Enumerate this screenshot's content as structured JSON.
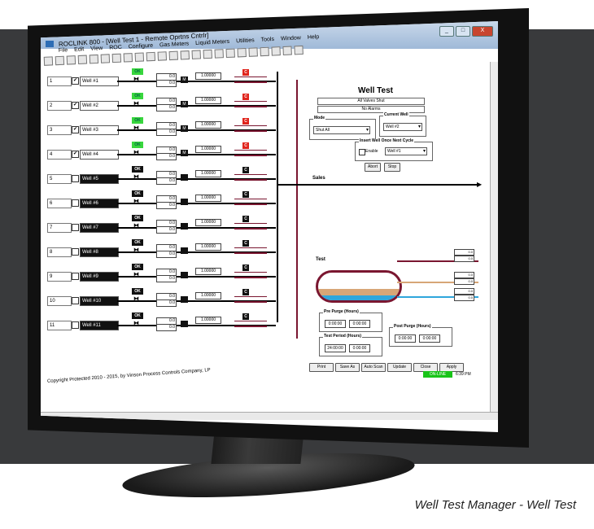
{
  "caption": "Well Test Manager - Well Test",
  "window": {
    "title": "ROCLINK 800 - [Well Test 1 - Remote Oprtns Cntrlr]",
    "buttons": [
      "_",
      "□",
      "X"
    ]
  },
  "menu": [
    "File",
    "Edit",
    "View",
    "ROC",
    "Configure",
    "Gas Meters",
    "Liquid Meters",
    "Utilities",
    "Tools",
    "Window",
    "Help"
  ],
  "wells": [
    {
      "num": "1",
      "checked": true,
      "name": "Well #1",
      "status": "OK",
      "ok_color": "green",
      "flow_a": "0.0",
      "flow_b": "0.0",
      "meter": "M",
      "factor": "1.00000",
      "c_color": "red"
    },
    {
      "num": "2",
      "checked": true,
      "name": "Well #2",
      "status": "OK",
      "ok_color": "green",
      "flow_a": "0.0",
      "flow_b": "0.0",
      "meter": "M",
      "factor": "1.00000",
      "c_color": "red"
    },
    {
      "num": "3",
      "checked": true,
      "name": "Well #3",
      "status": "OK",
      "ok_color": "green",
      "flow_a": "0.0",
      "flow_b": "0.0",
      "meter": "M",
      "factor": "1.00000",
      "c_color": "red"
    },
    {
      "num": "4",
      "checked": true,
      "name": "Well #4",
      "status": "OK",
      "ok_color": "green",
      "flow_a": "0.0",
      "flow_b": "0.0",
      "meter": "M",
      "factor": "1.00000",
      "c_color": "red"
    },
    {
      "num": "5",
      "checked": false,
      "name": "Well #5",
      "status": "OK",
      "ok_color": "black",
      "flow_a": "0.0",
      "flow_b": "0.0",
      "meter": "",
      "factor": "1.00000",
      "c_color": "black"
    },
    {
      "num": "6",
      "checked": false,
      "name": "Well #6",
      "status": "OK",
      "ok_color": "black",
      "flow_a": "0.0",
      "flow_b": "0.0",
      "meter": "",
      "factor": "1.00000",
      "c_color": "black"
    },
    {
      "num": "7",
      "checked": false,
      "name": "Well #7",
      "status": "OK",
      "ok_color": "black",
      "flow_a": "0.0",
      "flow_b": "0.0",
      "meter": "",
      "factor": "1.00000",
      "c_color": "black"
    },
    {
      "num": "8",
      "checked": false,
      "name": "Well #8",
      "status": "OK",
      "ok_color": "black",
      "flow_a": "0.0",
      "flow_b": "0.0",
      "meter": "",
      "factor": "1.00000",
      "c_color": "black"
    },
    {
      "num": "9",
      "checked": false,
      "name": "Well #9",
      "status": "OK",
      "ok_color": "black",
      "flow_a": "0.0",
      "flow_b": "0.0",
      "meter": "",
      "factor": "1.00000",
      "c_color": "black"
    },
    {
      "num": "10",
      "checked": false,
      "name": "Well #10",
      "status": "OK",
      "ok_color": "black",
      "flow_a": "0.0",
      "flow_b": "0.0",
      "meter": "",
      "factor": "1.00000",
      "c_color": "black"
    },
    {
      "num": "11",
      "checked": false,
      "name": "Well #11",
      "status": "OK",
      "ok_color": "black",
      "flow_a": "0.0",
      "flow_b": "0.0",
      "meter": "",
      "factor": "1.00000",
      "c_color": "black"
    }
  ],
  "panel": {
    "title": "Well Test",
    "status1": "All Valves Shut",
    "status2": "No Alarms",
    "mode_label": "Mode",
    "mode_value": "Shut All",
    "current_well_label": "Current Well",
    "current_well_value": "Well #2",
    "insert_label": "Insert Well Once Next Cycle",
    "enable_label": "Enable",
    "insert_value": "Well #1",
    "abort": "Abort",
    "stop": "Stop",
    "sales_label": "Sales",
    "test_label": "Test",
    "tank_values": [
      "0.0",
      "0.0",
      "0.0",
      "0.0",
      "0.0",
      "0.0"
    ],
    "pre_purge_label": "Pre Purge (Hours)",
    "pre_purge": [
      "0:00:00",
      "0:00:00"
    ],
    "test_period_label": "Test Period (Hours)",
    "test_period": [
      "24:00:00",
      "0:00:00"
    ],
    "post_purge_label": "Post Purge (Hours)",
    "post_purge": [
      "0:00:00",
      "0:00:00"
    ]
  },
  "footer": {
    "buttons": [
      "Print",
      "Save As",
      "Auto Scan",
      "Update",
      "Close",
      "Apply"
    ],
    "copyright": "Copyright Protected 2010 - 2015, by Vinson Process Controls Company, LP",
    "online": "ON-LINE",
    "time": "6:39 PM"
  },
  "colors": {
    "green": "#38d63d",
    "red": "#e0241c",
    "maroon": "#7a1630",
    "water": "#2fa6dc",
    "oil": "#d7a677",
    "online": "#19c419"
  }
}
